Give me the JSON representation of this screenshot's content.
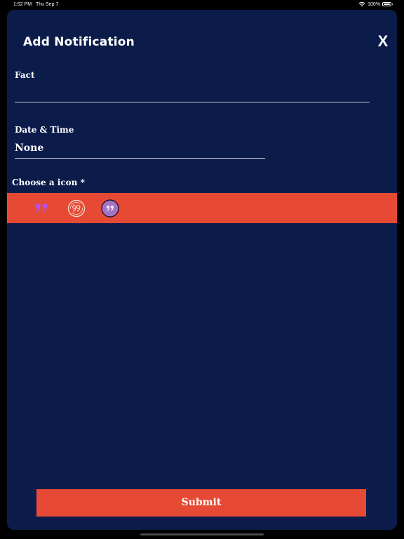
{
  "status_bar": {
    "time": "1:52 PM",
    "date": "Thu Sep 7",
    "battery_text": "100%"
  },
  "sheet": {
    "title": "Add Notification",
    "close_label": "X"
  },
  "form": {
    "fact_label": "Fact",
    "fact_value": "",
    "date_label": "Date & Time",
    "date_value": "None",
    "icon_label": "Choose a icon *",
    "icons": [
      "quote-icon",
      "quote-outline-circle-icon",
      "quote-filled-circle-icon"
    ],
    "submit_label": "Submit"
  },
  "colors": {
    "sheet_bg": "#0b1c4a",
    "accent": "#e64a35",
    "icon_purple": "#b84fe6",
    "icon_mauve": "#a575c4"
  }
}
